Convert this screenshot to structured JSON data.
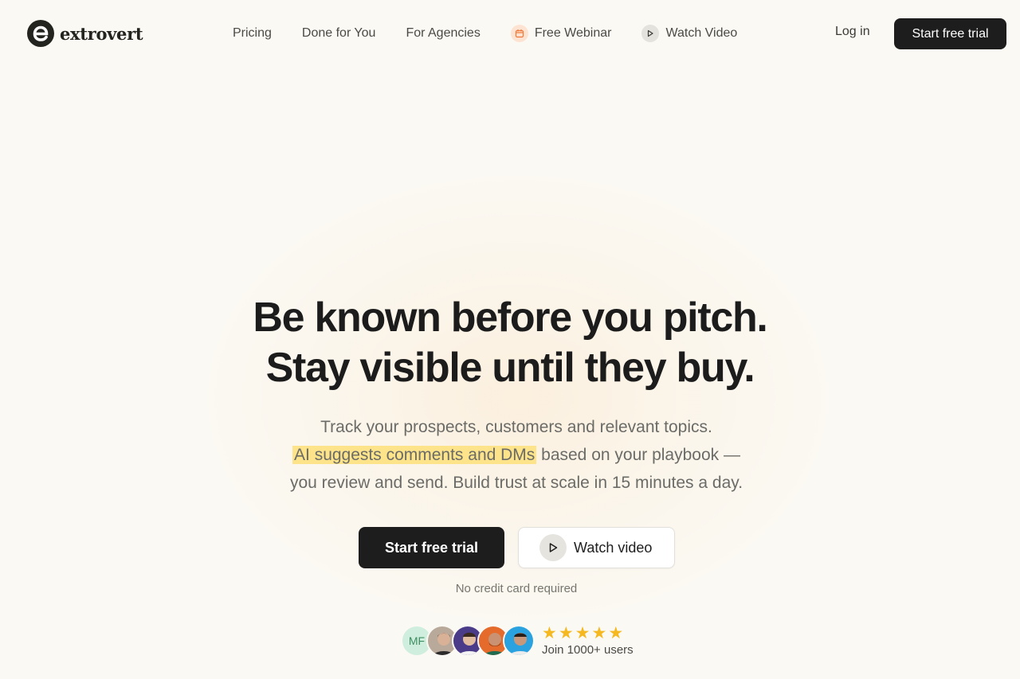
{
  "brand": {
    "name": "extrovert"
  },
  "nav": {
    "links": [
      {
        "label": "Pricing"
      },
      {
        "label": "Done for You"
      },
      {
        "label": "For Agencies"
      },
      {
        "label": "Free Webinar",
        "icon": "calendar-icon"
      },
      {
        "label": "Watch Video",
        "icon": "play-icon"
      }
    ],
    "login": "Log in",
    "cta": "Start free trial"
  },
  "hero": {
    "headline_line1": "Be known before you pitch.",
    "headline_line2": "Stay visible until they buy.",
    "sub_line1": "Track your prospects, customers and relevant topics.",
    "sub_highlight": "AI suggests comments and DMs",
    "sub_line2_rest": " based on your playbook —",
    "sub_line3": "you review and send. Build trust at scale in 15 minutes a day.",
    "primary_cta": "Start free trial",
    "secondary_cta": "Watch video",
    "note": "No credit card required"
  },
  "social_proof": {
    "avatar_initials": "MF",
    "rating_stars": 5,
    "users_label": "Join 1000+ users"
  },
  "colors": {
    "background": "#fbf9f3",
    "primary": "#1d1d1d",
    "highlight": "#fde38a",
    "star": "#f5b820"
  }
}
